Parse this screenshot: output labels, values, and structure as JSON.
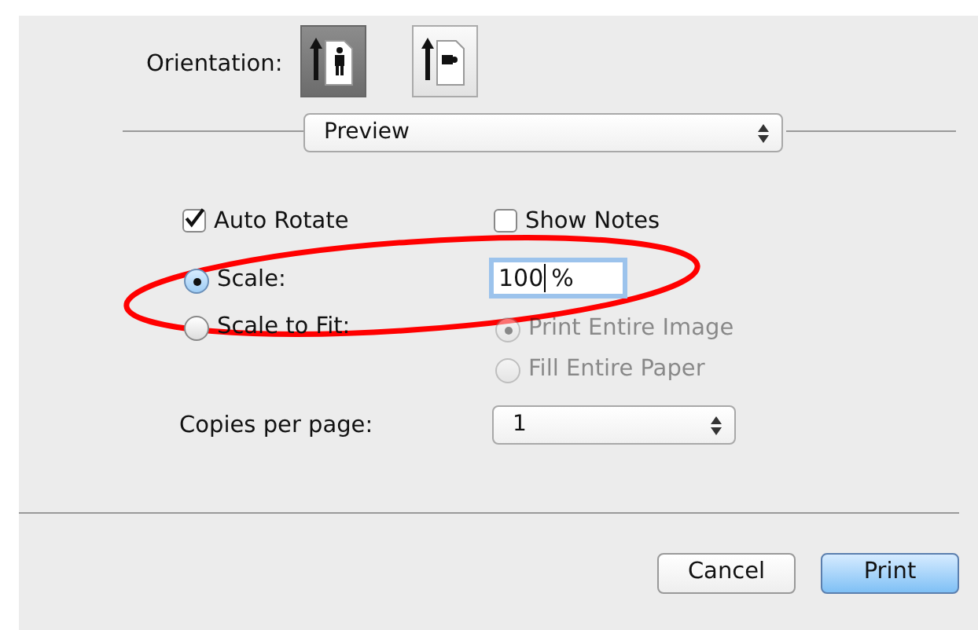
{
  "orientation": {
    "label": "Orientation:",
    "options": [
      {
        "kind": "portrait",
        "selected": true
      },
      {
        "kind": "landscape",
        "selected": false
      }
    ]
  },
  "app_popup": {
    "value": "Preview"
  },
  "options": [
    {
      "label": "Auto Rotate",
      "checked": true
    },
    {
      "label": "Show Notes",
      "checked": false
    }
  ],
  "scale_mode": [
    {
      "label": "Scale:",
      "selected": true
    },
    {
      "label": "Scale to Fit:",
      "selected": false
    }
  ],
  "scale_field": {
    "value": "100",
    "unit": "%"
  },
  "fit_mode": {
    "disabled": true,
    "items": [
      {
        "label": "Print Entire Image",
        "selected": true
      },
      {
        "label": "Fill Entire Paper",
        "selected": false
      }
    ]
  },
  "copies_per_page": {
    "label": "Copies per page:",
    "value": "1"
  },
  "buttons": [
    {
      "label": "Cancel",
      "kind": "normal"
    },
    {
      "label": "Print",
      "kind": "default"
    }
  ],
  "annotation": {
    "kind": "ellipse",
    "color": "#ff0000"
  }
}
